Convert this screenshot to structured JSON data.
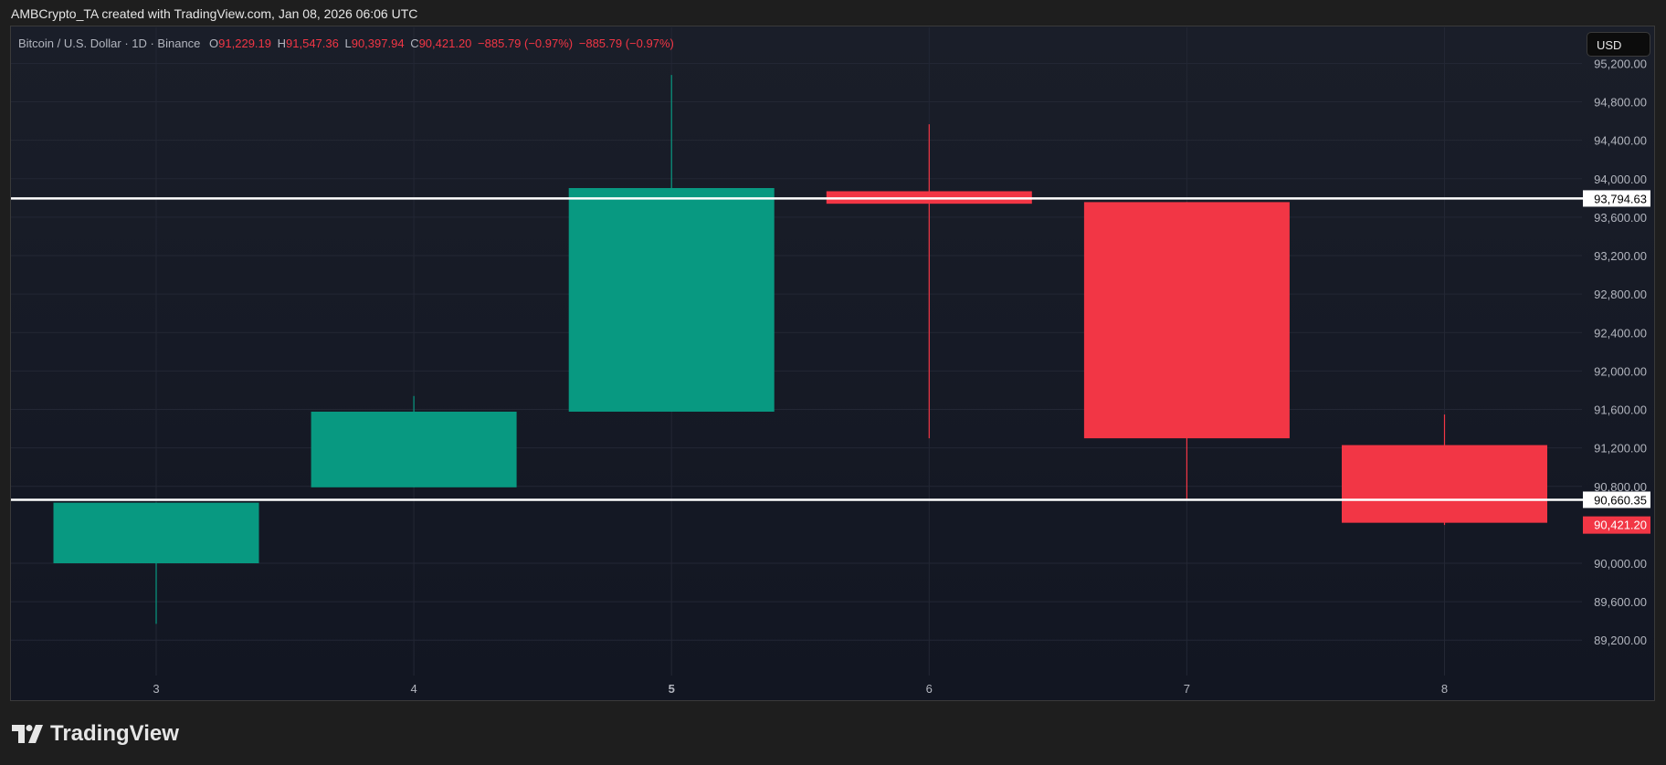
{
  "caption": "AMBCrypto_TA created with TradingView.com, Jan 08, 2026 06:06 UTC",
  "legend": {
    "symbol": "Bitcoin / U.S. Dollar · 1D · Binance",
    "o_label": "O",
    "o": "91,229.19",
    "h_label": "H",
    "h": "91,547.36",
    "l_label": "L",
    "l": "90,397.94",
    "c_label": "C",
    "c": "90,421.20",
    "change1": "−885.79 (−0.97%)",
    "change2": "−885.79 (−0.97%)"
  },
  "currency_button": "USD",
  "logo_text": "TradingView",
  "colors": {
    "up": "#089981",
    "down": "#f23645",
    "level_line": "#ffffff",
    "grid": "#232734"
  },
  "chart_data": {
    "type": "candlestick",
    "title": "Bitcoin / U.S. Dollar · 1D · Binance",
    "x": [
      "3",
      "4",
      "5",
      "6",
      "7",
      "8"
    ],
    "bold_x": [
      "5"
    ],
    "candles": [
      {
        "day": "3",
        "open": 90000,
        "high": 90630,
        "low": 89370,
        "close": 90630
      },
      {
        "day": "4",
        "open": 90790,
        "high": 91740,
        "low": 90790,
        "close": 91577
      },
      {
        "day": "5",
        "open": 91577,
        "high": 95080,
        "low": 91577,
        "close": 93903
      },
      {
        "day": "6",
        "open": 93870,
        "high": 94567,
        "low": 91300,
        "close": 93740
      },
      {
        "day": "7",
        "open": 93757,
        "high": 93757,
        "low": 90665,
        "close": 91300
      },
      {
        "day": "8",
        "open": 91229.19,
        "high": 91547.36,
        "low": 90397.94,
        "close": 90421.2
      }
    ],
    "y_ticks": [
      95200,
      94800,
      94400,
      94000,
      93600,
      93200,
      92800,
      92400,
      92000,
      91600,
      91200,
      90800,
      90000,
      89600,
      89200
    ],
    "y_tick_labels": [
      "95,200.00",
      "94,800.00",
      "94,400.00",
      "94,000.00",
      "93,600.00",
      "93,200.00",
      "92,800.00",
      "92,400.00",
      "92,000.00",
      "91,600.00",
      "91,200.00",
      "90,800.00",
      "90,000.00",
      "89,600.00",
      "89,200.00"
    ],
    "ylim": [
      88900,
      95300
    ],
    "horizontal_lines": [
      {
        "value": 93794.63,
        "label": "93,794.63"
      },
      {
        "value": 90660.35,
        "label": "90,660.35"
      }
    ],
    "last_price": {
      "value": 90421.2,
      "label": "90,421.20"
    },
    "grid": true
  }
}
